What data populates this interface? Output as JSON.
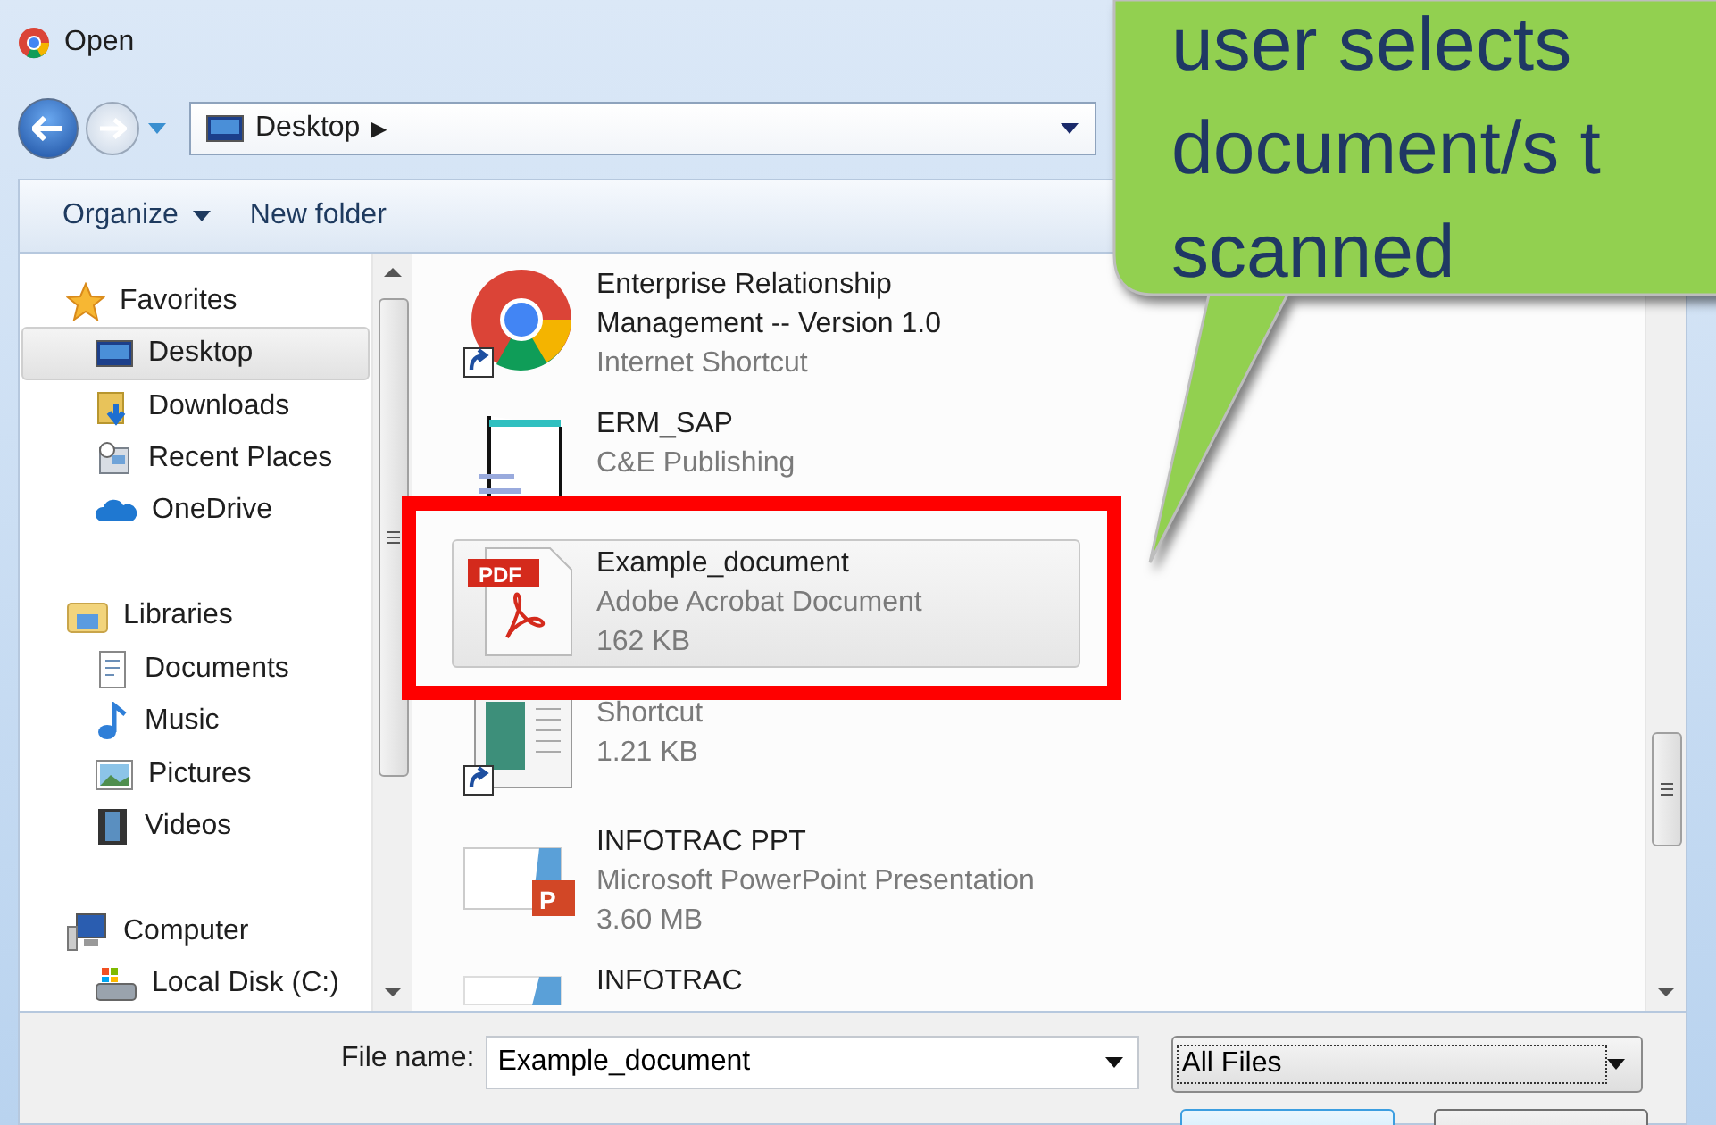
{
  "window": {
    "title": "Open"
  },
  "address_bar": {
    "location": "Desktop",
    "separator": "▶"
  },
  "toolbar": {
    "organize": "Organize",
    "new_folder": "New folder"
  },
  "nav_pane": {
    "groups": [
      {
        "label": "Favorites",
        "children": [
          {
            "label": "Desktop",
            "selected": true
          },
          {
            "label": "Downloads",
            "selected": false
          },
          {
            "label": "Recent Places",
            "selected": false
          },
          {
            "label": "OneDrive",
            "selected": false
          }
        ]
      },
      {
        "label": "Libraries",
        "children": [
          {
            "label": "Documents",
            "selected": false
          },
          {
            "label": "Music",
            "selected": false
          },
          {
            "label": "Pictures",
            "selected": false
          },
          {
            "label": "Videos",
            "selected": false
          }
        ]
      },
      {
        "label": "Computer",
        "children": [
          {
            "label": "Local Disk (C:)",
            "selected": false
          }
        ]
      }
    ]
  },
  "files": [
    {
      "name": "Enterprise Relationship Management -- Version 1.0",
      "details": [
        "Internet Shortcut"
      ],
      "selected": false
    },
    {
      "name": "ERM_SAP",
      "details": [
        "C&E Publishing"
      ],
      "selected": false
    },
    {
      "name": "Example_document",
      "details": [
        "Adobe Acrobat Document",
        "162 KB"
      ],
      "icon_badge": "PDF",
      "selected": true
    },
    {
      "details": [
        "Shortcut",
        "1.21 KB"
      ],
      "selected": false
    },
    {
      "name": "INFOTRAC PPT",
      "details": [
        "Microsoft PowerPoint Presentation",
        "3.60 MB"
      ],
      "icon_badge": "P",
      "selected": false
    },
    {
      "name": "INFOTRAC",
      "selected": false
    }
  ],
  "bottom_bar": {
    "file_name_label": "File name:",
    "file_name": "Example_document",
    "file_type": "All Files"
  },
  "callout": {
    "lines": [
      "user selects",
      "document/s t",
      "scanned"
    ]
  }
}
